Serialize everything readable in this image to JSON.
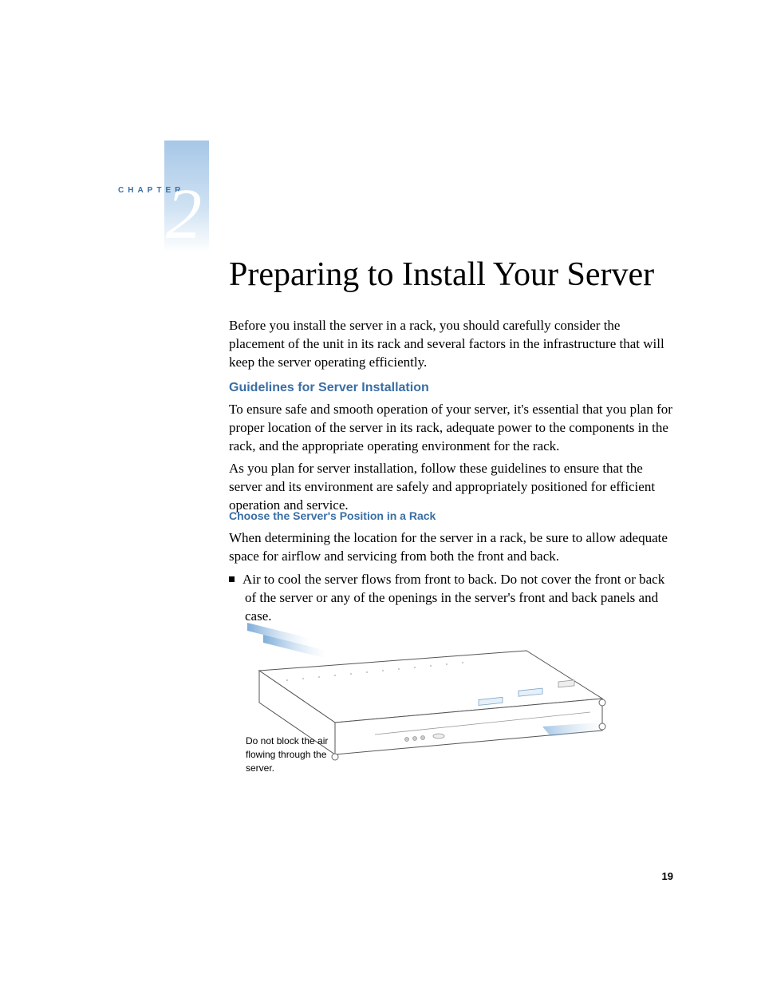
{
  "chapter": {
    "label": "CHAPTER",
    "number": "2"
  },
  "title": "Preparing to Install Your Server",
  "intro": "Before you install the server in a rack, you should carefully consider the placement of the unit in its rack and several factors in the infrastructure that will keep the server operating efficiently.",
  "section1": {
    "heading": "Guidelines for Server Installation",
    "para1": "To ensure safe and smooth operation of your server, it's essential that you plan for proper location of the server in its rack, adequate power to the components in the rack, and the appropriate operating environment for the rack.",
    "para2": "As you plan for server installation, follow these guidelines to ensure that the server and its environment are safely and appropriately positioned for efficient operation and service."
  },
  "subsection1": {
    "heading": "Choose the Server's Position in a Rack",
    "para": "When determining the location for the server in a rack, be sure to allow adequate space for airflow and servicing from both the front and back.",
    "bullet1": "Air to cool the server flows from front to back. Do not cover the front or back of the server or any of the openings in the server's front and back panels and case."
  },
  "figure": {
    "caption": "Do not block the air flowing through the server."
  },
  "page_number": "19"
}
